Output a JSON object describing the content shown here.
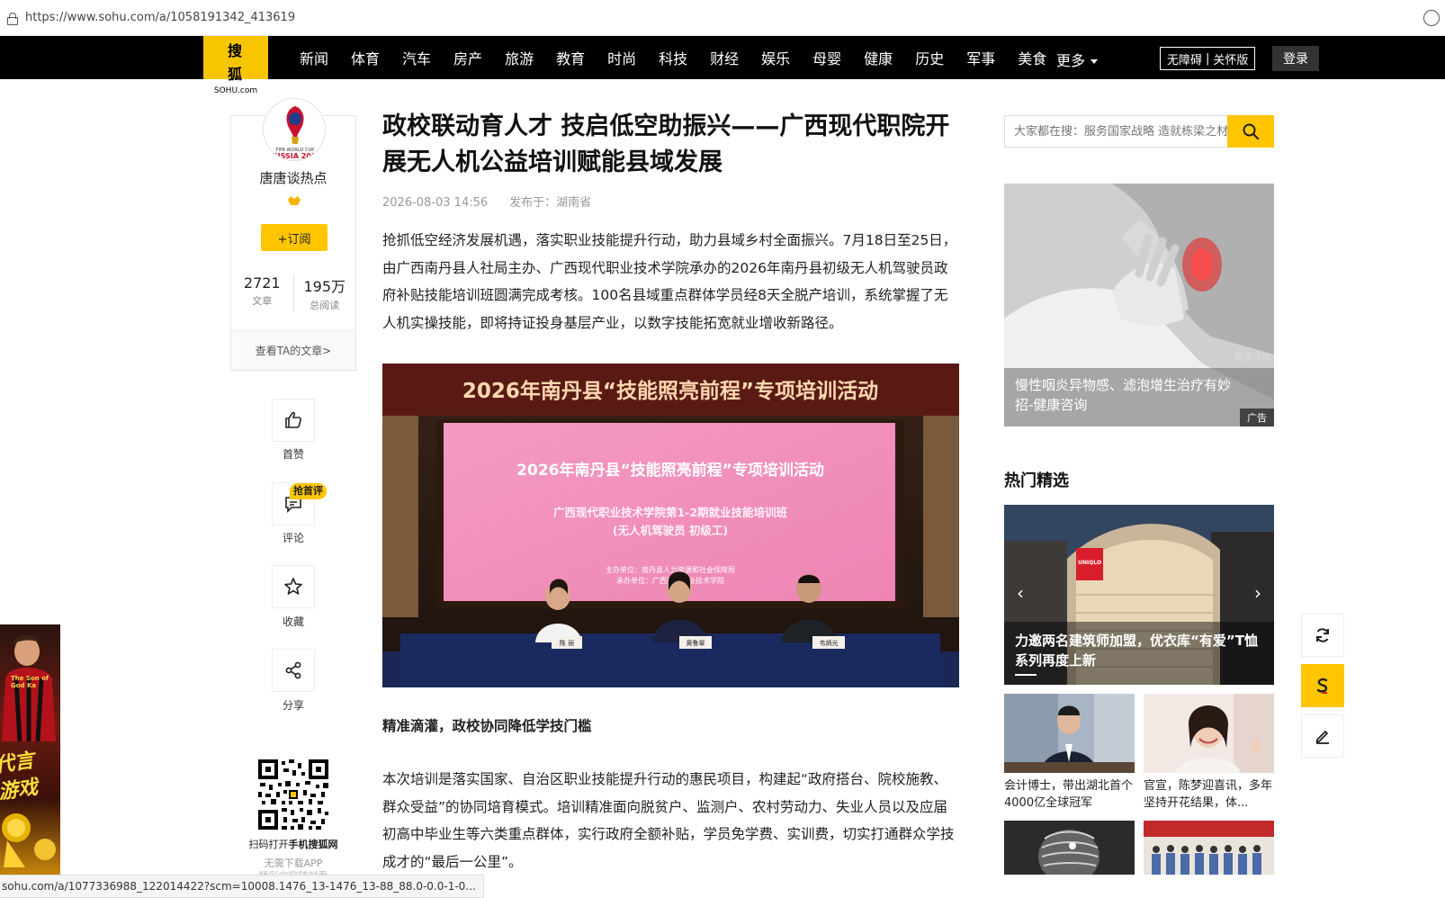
{
  "browser": {
    "url": "https://www.sohu.com/a/1058191342_413619",
    "status_url": "sohu.com/a/1077336988_122014422?scm=10008.1476_13-1476_13-88_88.0-0.0-1-0..."
  },
  "nav": {
    "logo_cn": "搜 狐",
    "logo_en": "SOHU.com",
    "items": [
      "新闻",
      "体育",
      "汽车",
      "房产",
      "旅游",
      "教育",
      "时尚",
      "科技",
      "财经",
      "娱乐",
      "母婴",
      "健康",
      "历史",
      "军事",
      "美食"
    ],
    "more": "更多",
    "a11y_left": "无障碍",
    "a11y_right": "关怀版",
    "login": "登录",
    "colors": {
      "bar": "#000000",
      "accent": "#ffc600"
    }
  },
  "author": {
    "name": "唐唐谈热点",
    "subscribe": "+订阅",
    "articles_count": "2721",
    "articles_label": "文章",
    "reads_count": "195万",
    "reads_label": "总阅读",
    "view_articles": "查看TA的文章>"
  },
  "actions": {
    "like": "首赞",
    "comment": "评论",
    "comment_tag": "抢首评",
    "collect": "收藏",
    "share": "分享"
  },
  "qr": {
    "text_prefix": "扫码打开",
    "text_bold": "手机搜狐网",
    "sub": "无需下载APP",
    "sub2": "精彩内容随时看"
  },
  "left_ad": {
    "t1": "The Son of God Ka",
    "t2": "代言 游戏"
  },
  "article": {
    "title": "政校联动育人才 技启低空助振兴——广西现代职院开展无人机公益培训赋能县域发展",
    "date": "2026-08-03 14:56",
    "location": "发布于：湖南省",
    "para1": "抢抓低空经济发展机遇，落实职业技能提升行动，助力县域乡村全面振兴。7月18日至25日，由广西南丹县人社局主办、广西现代职业技术学院承办的2026年南丹县初级无人机驾驶员政府补贴技能培训班圆满完成考核。100名县域重点群体学员经8天全脱产培训，系统掌握了无人机实操技能，即将持证投身基层产业，以数字技能拓宽就业增收新路径。",
    "subhead": "精准滴灌，政校协同降低学技门槛",
    "para2": "本次培训是落实国家、自治区职业技能提升行动的惠民项目，构建起“政府搭台、院校施教、群众受益”的协同培育模式。培训精准面向脱贫户、监测户、农村劳动力、失业人员以及应届初高中毕业生等六类重点群体，实行政府全额补贴，学员免学费、实训费，切实打通群众学技成才的“最后一公里”。",
    "figure": {
      "banner": "2026年南丹县“技能照亮前程”专项培训活动",
      "screen_title": "2026年南丹县“技能照亮前程”专项培训活动",
      "screen_line1": "广西现代职业技术学院第1-2期就业技能培训班",
      "screen_line2": "(无人机驾驶员 初级工)",
      "screen_org1": "主办单位：南丹县人力资源和社会保障局",
      "screen_org2": "承办单位：广西现代职业技术学院",
      "name1": "陈  丽",
      "name2": "黄鲁翠",
      "name3": "韦炳光"
    }
  },
  "sidebar": {
    "search_placeholder": "大家都在搜：服务国家战略 造就栋梁之材",
    "ad_caption": "慢性咽炎异物感、滤泡增生治疗有妙招-健康咨询",
    "ad_tag": "广告",
    "ad_watermark": "健康咨询",
    "section_title": "热门精选",
    "hot_main_caption": "力邀两名建筑师加盟，优衣库“有爱”T恤系列再度上新",
    "hot_main_sign": "UNIQLO",
    "thumbs": [
      {
        "caption": "会计博士，带出湖北首个4000亿全球冠军"
      },
      {
        "caption": "官宣，陈梦迎喜讯，多年坚持开花结果，体..."
      }
    ]
  }
}
